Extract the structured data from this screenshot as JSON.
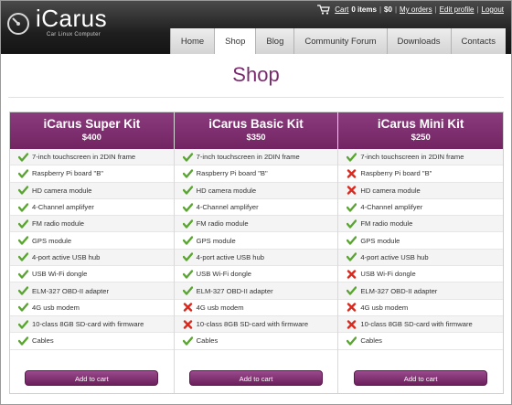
{
  "brand": {
    "name": "iCarus",
    "tagline": "Car Linux Computer"
  },
  "userbar": {
    "cart_label": "Cart",
    "items_text": "0 items",
    "amount": "$0",
    "my_orders": "My orders",
    "edit_profile": "Edit profile",
    "logout": "Logout"
  },
  "nav": {
    "tabs": [
      {
        "label": "Home"
      },
      {
        "label": "Shop"
      },
      {
        "label": "Blog"
      },
      {
        "label": "Community Forum"
      },
      {
        "label": "Downloads"
      },
      {
        "label": "Contacts"
      }
    ],
    "active": "Shop"
  },
  "page_title": "Shop",
  "colors": {
    "accent": "#7a2a6e",
    "check": "#5aa531",
    "cross": "#d9291e"
  },
  "plans": [
    {
      "name": "iCarus Super Kit",
      "price": "$400",
      "button": "Add to cart",
      "features": [
        {
          "text": "7-inch touchscreen in 2DIN frame",
          "included": true
        },
        {
          "text": "Raspberry Pi board \"B\"",
          "included": true
        },
        {
          "text": "HD camera module",
          "included": true
        },
        {
          "text": "4-Channel amplifyer",
          "included": true
        },
        {
          "text": "FM radio module",
          "included": true
        },
        {
          "text": "GPS module",
          "included": true
        },
        {
          "text": "4-port active USB hub",
          "included": true
        },
        {
          "text": "USB Wi-Fi dongle",
          "included": true
        },
        {
          "text": "ELM-327 OBD-II adapter",
          "included": true
        },
        {
          "text": "4G usb modem",
          "included": true
        },
        {
          "text": "10-class 8GB SD-card with firmware",
          "included": true
        },
        {
          "text": "Cables",
          "included": true
        }
      ]
    },
    {
      "name": "iCarus Basic Kit",
      "price": "$350",
      "button": "Add to cart",
      "features": [
        {
          "text": "7-inch touchscreen in 2DIN frame",
          "included": true
        },
        {
          "text": "Raspberry Pi board \"B\"",
          "included": true
        },
        {
          "text": "HD camera module",
          "included": true
        },
        {
          "text": "4-Channel amplifyer",
          "included": true
        },
        {
          "text": "FM radio module",
          "included": true
        },
        {
          "text": "GPS module",
          "included": true
        },
        {
          "text": "4-port active USB hub",
          "included": true
        },
        {
          "text": "USB Wi-Fi dongle",
          "included": true
        },
        {
          "text": "ELM-327 OBD-II adapter",
          "included": true
        },
        {
          "text": "4G usb modem",
          "included": false
        },
        {
          "text": "10-class 8GB SD-card with firmware",
          "included": false
        },
        {
          "text": "Cables",
          "included": true
        }
      ]
    },
    {
      "name": "iCarus Mini Kit",
      "price": "$250",
      "button": "Add to cart",
      "features": [
        {
          "text": "7-inch touchscreen in 2DIN frame",
          "included": true
        },
        {
          "text": "Raspberry Pi board \"B\"",
          "included": false
        },
        {
          "text": "HD camera module",
          "included": false
        },
        {
          "text": "4-Channel amplifyer",
          "included": true
        },
        {
          "text": "FM radio module",
          "included": true
        },
        {
          "text": "GPS module",
          "included": true
        },
        {
          "text": "4-port active USB hub",
          "included": true
        },
        {
          "text": "USB Wi-Fi dongle",
          "included": false
        },
        {
          "text": "ELM-327 OBD-II adapter",
          "included": true
        },
        {
          "text": "4G usb modem",
          "included": false
        },
        {
          "text": "10-class 8GB SD-card with firmware",
          "included": false
        },
        {
          "text": "Cables",
          "included": true
        }
      ]
    }
  ]
}
